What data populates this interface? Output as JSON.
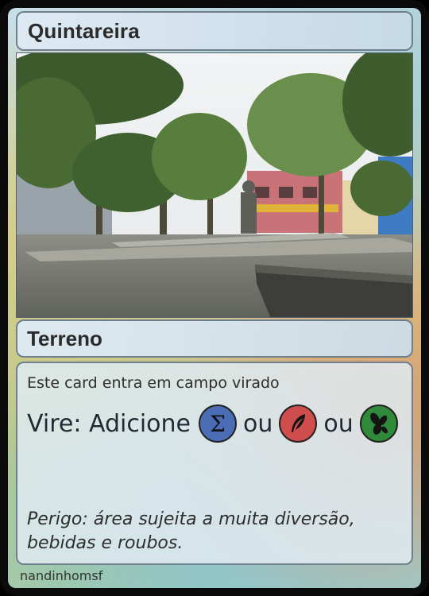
{
  "card": {
    "name": "Quintareira",
    "type": "Terreno",
    "rules_line1": "Este card entra em campo virado",
    "rules_line2_prefix": "Vire: Adicione",
    "conjunction": "ou",
    "symbols": [
      {
        "icon": "sigma-icon",
        "color": "#4a6db5",
        "glyph": "Σ"
      },
      {
        "icon": "feather-icon",
        "color": "#cf4d4d"
      },
      {
        "icon": "leaves-icon",
        "color": "#2f8a3c"
      }
    ],
    "flavor_text": "Perigo: área sujeita a muita diversão, bebidas e roubos.",
    "artist": "nandinhomsf"
  }
}
